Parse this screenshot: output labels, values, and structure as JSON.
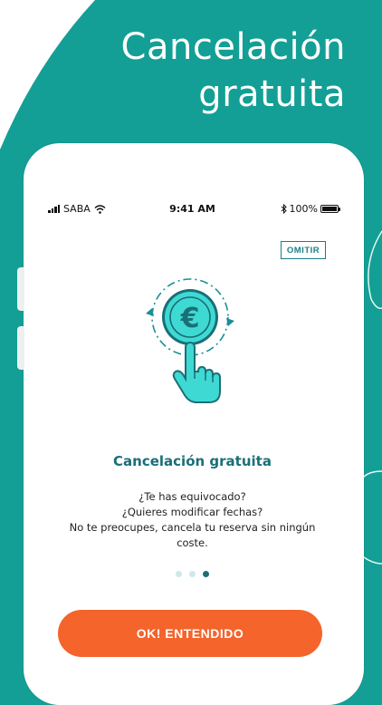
{
  "banner": {
    "headline_line1": "Cancelación",
    "headline_line2": "gratuita"
  },
  "status_bar": {
    "carrier": "SABA",
    "time": "9:41 AM",
    "battery_label": "100%",
    "battery_level": 1.0
  },
  "onboarding": {
    "skip_label": "OMITIR",
    "title": "Cancelación gratuita",
    "description_lines": [
      "¿Te has equivocado?",
      "¿Quieres modificar fechas?",
      "No te preocupes, cancela tu reserva sin ningún",
      "coste."
    ],
    "illustration_symbol": "€",
    "pagination": {
      "total": 3,
      "active_index": 2
    },
    "cta_label": "OK! ENTENDIDO"
  },
  "colors": {
    "background": "#139f95",
    "accent_teal": "#1a6f77",
    "cta_orange": "#f4642b",
    "coin_fill": "#3fd9d3",
    "dot_inactive": "#cfe8e8",
    "dot_active": "#1a6f77"
  },
  "icons": {
    "wifi": "wifi-icon",
    "bluetooth": "bluetooth-icon",
    "battery": "battery-icon",
    "signal": "signal-icon",
    "hand": "hand-pointer-icon",
    "refresh": "refresh-arrows-icon"
  }
}
